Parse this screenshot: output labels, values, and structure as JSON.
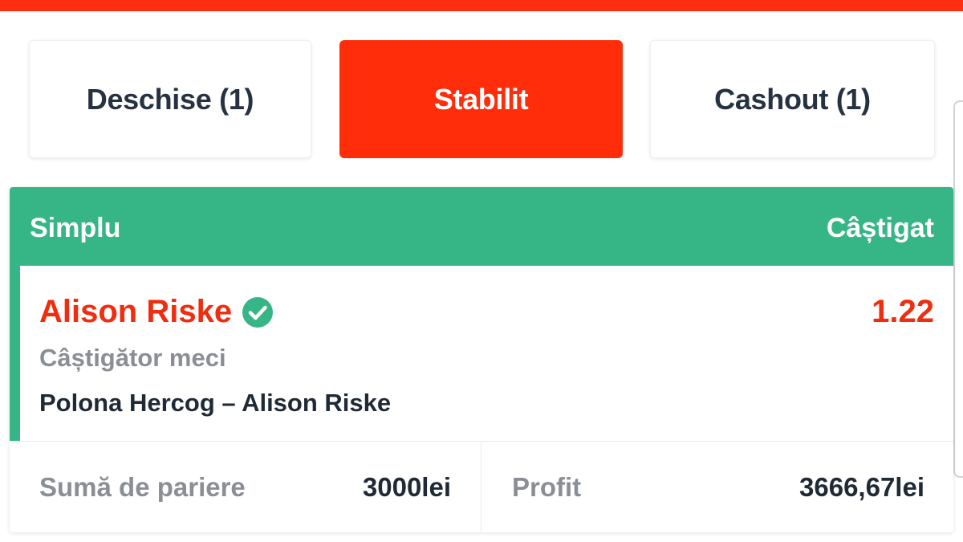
{
  "colors": {
    "brand_red": "#ff2d0a",
    "win_green": "#36b686",
    "odds_red": "#ef2d10"
  },
  "tabs": [
    {
      "label": "Deschise (1)",
      "active": false
    },
    {
      "label": "Stabilit",
      "active": true
    },
    {
      "label": "Cashout (1)",
      "active": false
    }
  ],
  "bet": {
    "type": "Simplu",
    "status": "Câștigat",
    "selection": "Alison Riske",
    "selection_icon": "check-circle-icon",
    "odds": "1.22",
    "market": "Câștigător meci",
    "event": "Polona Hercog – Alison Riske",
    "stake_label": "Sumă de pariere",
    "stake_value": "3000lei",
    "profit_label": "Profit",
    "profit_value": "3666,67lei"
  }
}
